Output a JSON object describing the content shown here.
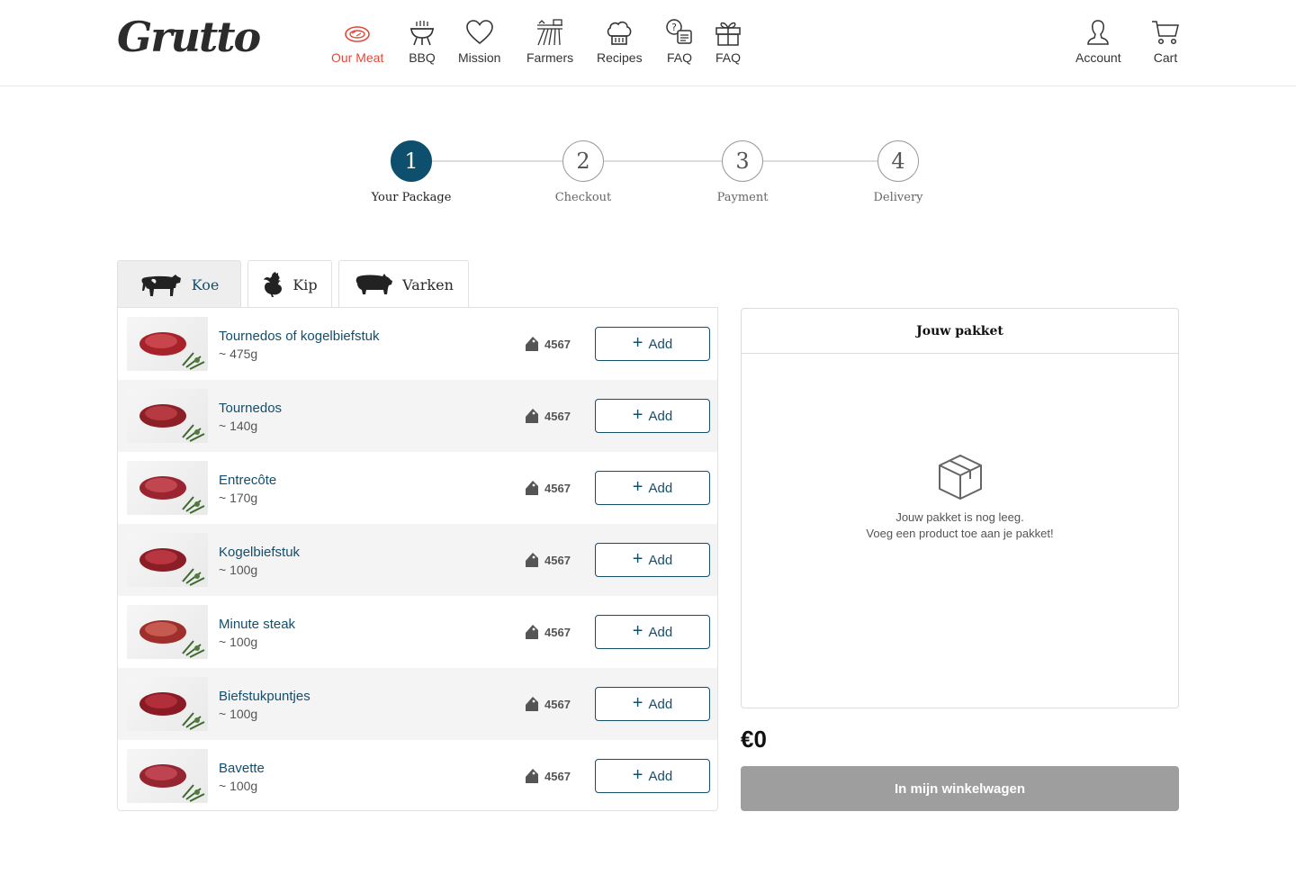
{
  "brand": {
    "logo_text": "Grutto"
  },
  "nav": {
    "items": [
      {
        "label": "Our Meat",
        "icon": "steak-icon",
        "active": true
      },
      {
        "label": "BBQ",
        "icon": "bbq-grill-icon"
      },
      {
        "label": "Mission",
        "icon": "heart-icon"
      },
      {
        "label": "Farmers",
        "icon": "farm-field-icon"
      },
      {
        "label": "Recipes",
        "icon": "chef-hat-icon"
      },
      {
        "label": "FAQ",
        "icon": "faq-chat-icon"
      },
      {
        "label": "FAQ",
        "icon": "gift-icon"
      }
    ],
    "account_label": "Account",
    "cart_label": "Cart"
  },
  "stepper": {
    "steps": [
      {
        "number": "1",
        "label": "Your Package",
        "active": true
      },
      {
        "number": "2",
        "label": "Checkout"
      },
      {
        "number": "3",
        "label": "Payment"
      },
      {
        "number": "4",
        "label": "Delivery"
      }
    ]
  },
  "tabs": [
    {
      "label": "Koe",
      "icon": "cow-icon",
      "active": true
    },
    {
      "label": "Kip",
      "icon": "chicken-icon"
    },
    {
      "label": "Varken",
      "icon": "pig-icon"
    }
  ],
  "products": [
    {
      "name": "Tournedos of kogelbiefstuk",
      "weight": "~ 475g",
      "farmers": "4567",
      "add_label": "Add"
    },
    {
      "name": "Tournedos",
      "weight": "~ 140g",
      "farmers": "4567",
      "add_label": "Add"
    },
    {
      "name": "Entrecôte",
      "weight": "~ 170g",
      "farmers": "4567",
      "add_label": "Add"
    },
    {
      "name": "Kogelbiefstuk",
      "weight": "~ 100g",
      "farmers": "4567",
      "add_label": "Add"
    },
    {
      "name": "Minute steak",
      "weight": "~ 100g",
      "farmers": "4567",
      "add_label": "Add"
    },
    {
      "name": "Biefstukpuntjes",
      "weight": "~ 100g",
      "farmers": "4567",
      "add_label": "Add"
    },
    {
      "name": "Bavette",
      "weight": "~ 100g",
      "farmers": "4567",
      "add_label": "Add"
    }
  ],
  "package": {
    "title": "Jouw pakket",
    "empty_line1": "Jouw pakket is nog leeg.",
    "empty_line2": "Voeg een product toe aan je pakket!",
    "total": "€0",
    "cart_button": "In mijn winkelwagen"
  },
  "colors": {
    "accent": "#134e6d",
    "active_nav": "#e0493a",
    "button_disabled": "#9e9e9e"
  }
}
